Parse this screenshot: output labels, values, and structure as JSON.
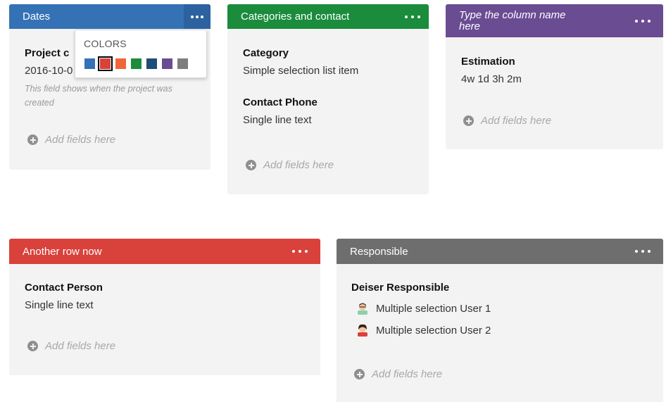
{
  "columns": [
    {
      "title": "Dates",
      "color": "#3571b5",
      "fields": [
        {
          "name": "Project c",
          "value": "2016-10-0",
          "help": "This field shows when the project was created"
        }
      ],
      "add_label": "Add fields here"
    },
    {
      "title": "Categories and contact",
      "color": "#1a8c3c",
      "fields": [
        {
          "name": "Category",
          "value": "Simple selection list item"
        },
        {
          "name": "Contact Phone",
          "value": "Single line text"
        }
      ],
      "add_label": "Add fields here"
    },
    {
      "title": "Type the column name here",
      "color": "#6a4c93",
      "fields": [
        {
          "name": "Estimation",
          "value": "4w 1d 3h 2m"
        }
      ],
      "add_label": "Add fields here"
    },
    {
      "title": "Another row now",
      "color": "#d9413b",
      "fields": [
        {
          "name": "Contact Person",
          "value": "Single line text"
        }
      ],
      "add_label": "Add fields here"
    },
    {
      "title": "Responsible",
      "color": "#6e6e6e",
      "fields": [
        {
          "name": "Deiser Responsible",
          "users": [
            "Multiple selection User 1",
            "Multiple selection User 2"
          ]
        }
      ],
      "add_label": "Add fields here"
    }
  ],
  "color_popup": {
    "title": "COLORS",
    "selected_index": 1,
    "swatches": [
      "#3571b5",
      "#d9413b",
      "#f0663a",
      "#1a8c3c",
      "#1e4d78",
      "#6a4c93",
      "#7d7d7d"
    ]
  },
  "icons": {
    "menu": "more-dots-icon",
    "add": "plus-circle-icon",
    "user": "user-avatar-icon"
  }
}
